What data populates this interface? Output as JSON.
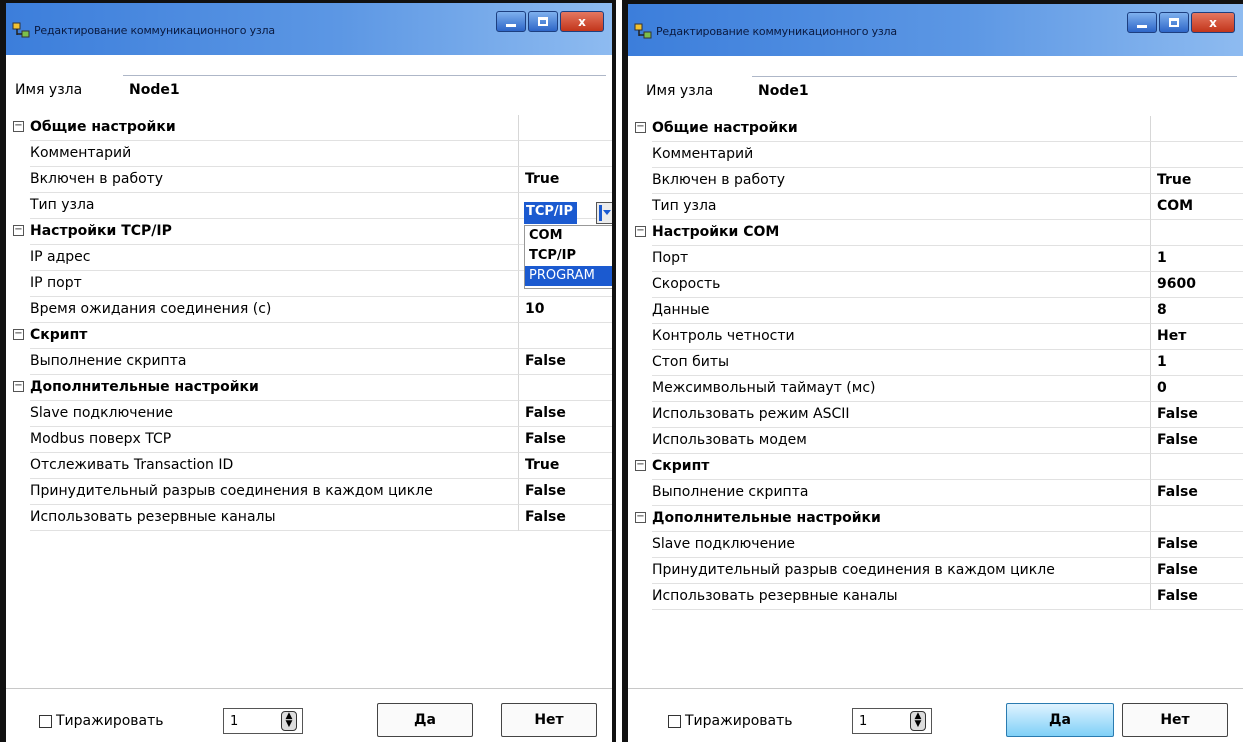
{
  "left": {
    "title": "Редактирование коммуникационного узла",
    "name_label": "Имя узла",
    "name_value": "Node1",
    "rows": [
      {
        "kind": "cat",
        "name": "Общие настройки",
        "value": ""
      },
      {
        "kind": "prop",
        "name": "Комментарий",
        "value": ""
      },
      {
        "kind": "prop",
        "name": "Включен в работу",
        "value": "True"
      },
      {
        "kind": "prop",
        "name": "Тип узла",
        "value": ""
      },
      {
        "kind": "cat",
        "name": "Настройки TCP/IP",
        "value": ""
      },
      {
        "kind": "prop",
        "name": "IP адрес",
        "value": ""
      },
      {
        "kind": "prop",
        "name": "IP порт",
        "value": ""
      },
      {
        "kind": "prop",
        "name": "Время ожидания соединения (с)",
        "value": "10"
      },
      {
        "kind": "cat",
        "name": "Скрипт",
        "value": ""
      },
      {
        "kind": "prop",
        "name": "Выполнение скрипта",
        "value": "False"
      },
      {
        "kind": "cat",
        "name": "Дополнительные настройки",
        "value": ""
      },
      {
        "kind": "prop",
        "name": "Slave подключение",
        "value": "False"
      },
      {
        "kind": "prop",
        "name": "Modbus поверх TCP",
        "value": "False"
      },
      {
        "kind": "prop",
        "name": "Отслеживать Transaction ID",
        "value": "True"
      },
      {
        "kind": "prop",
        "name": "Принудительный разрыв соединения в каждом цикле",
        "value": "False"
      },
      {
        "kind": "prop",
        "name": "Использовать резервные каналы",
        "value": "False"
      }
    ],
    "dropdown": {
      "current": "TCP/IP",
      "options": [
        "COM",
        "TCP/IP",
        "PROGRAM"
      ],
      "selected_option": "PROGRAM"
    },
    "replicate_label": "Тиражировать",
    "replicate_count": "1",
    "ok_label": "Да",
    "cancel_label": "Нет"
  },
  "right": {
    "title": "Редактирование коммуникационного узла",
    "name_label": "Имя узла",
    "name_value": "Node1",
    "rows": [
      {
        "kind": "cat",
        "name": "Общие настройки",
        "value": ""
      },
      {
        "kind": "prop",
        "name": "Комментарий",
        "value": ""
      },
      {
        "kind": "prop",
        "name": "Включен в работу",
        "value": "True"
      },
      {
        "kind": "prop",
        "name": "Тип узла",
        "value": "COM"
      },
      {
        "kind": "cat",
        "name": "Настройки COM",
        "value": ""
      },
      {
        "kind": "prop",
        "name": "Порт",
        "value": "1"
      },
      {
        "kind": "prop",
        "name": "Скорость",
        "value": "9600"
      },
      {
        "kind": "prop",
        "name": "Данные",
        "value": "8"
      },
      {
        "kind": "prop",
        "name": "Контроль четности",
        "value": "Нет"
      },
      {
        "kind": "prop",
        "name": "Стоп биты",
        "value": "1"
      },
      {
        "kind": "prop",
        "name": "Межсимвольный таймаут (мс)",
        "value": "0"
      },
      {
        "kind": "prop",
        "name": "Использовать режим ASCII",
        "value": "False"
      },
      {
        "kind": "prop",
        "name": "Использовать модем",
        "value": "False"
      },
      {
        "kind": "cat",
        "name": "Скрипт",
        "value": ""
      },
      {
        "kind": "prop",
        "name": "Выполнение скрипта",
        "value": "False"
      },
      {
        "kind": "cat",
        "name": "Дополнительные настройки",
        "value": ""
      },
      {
        "kind": "prop",
        "name": "Slave подключение",
        "value": "False"
      },
      {
        "kind": "prop",
        "name": "Принудительный разрыв соединения в каждом цикле",
        "value": "False"
      },
      {
        "kind": "prop",
        "name": "Использовать резервные каналы",
        "value": "False"
      }
    ],
    "replicate_label": "Тиражировать",
    "replicate_count": "1",
    "ok_label": "Да",
    "cancel_label": "Нет"
  },
  "icons": {
    "app": "node-app-icon",
    "minimize": "minimize-icon",
    "maximize": "maximize-icon",
    "close": "close-icon",
    "expander": "collapse-icon",
    "spin": "spinner-icon",
    "dropdown_arrow": "chevron-down-icon"
  },
  "colors": {
    "titlebar_start": "#3c7edb",
    "titlebar_end": "#8ebbf0",
    "selection": "#1b5ad0",
    "ok_button": "#7fd0f7"
  }
}
